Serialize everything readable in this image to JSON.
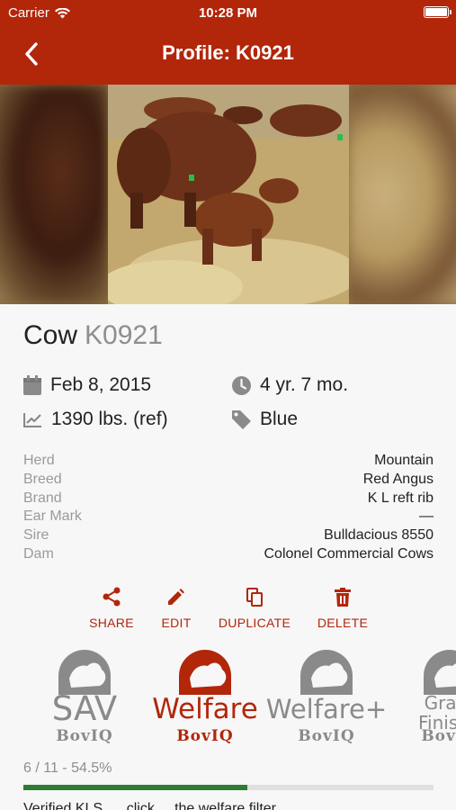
{
  "status_bar": {
    "carrier": "Carrier",
    "time": "10:28 PM",
    "wifi_icon": "wifi-icon",
    "battery_icon": "battery-icon"
  },
  "nav": {
    "title": "Profile: K0921",
    "back_icon": "chevron-left-icon"
  },
  "animal": {
    "kind": "Cow",
    "tag": "K0921",
    "birth_date": "Feb 8, 2015",
    "age": "4 yr. 7 mo.",
    "weight": "1390 lbs. (ref)",
    "tag_color": "Blue"
  },
  "details": [
    {
      "label": "Herd",
      "value": "Mountain"
    },
    {
      "label": "Breed",
      "value": "Red Angus"
    },
    {
      "label": "Brand",
      "value": "K L reft rib"
    },
    {
      "label": "Ear Mark",
      "value": "—"
    },
    {
      "label": "Sire",
      "value": "Bulldacious 8550"
    },
    {
      "label": "Dam",
      "value": "Colonel Commercial Cows"
    }
  ],
  "actions": [
    {
      "label": "SHARE",
      "icon": "share-icon"
    },
    {
      "label": "EDIT",
      "icon": "pencil-icon"
    },
    {
      "label": "DUPLICATE",
      "icon": "copy-icon"
    },
    {
      "label": "DELETE",
      "icon": "trash-icon"
    }
  ],
  "programs": [
    {
      "big": "SAV",
      "small": "BovIQ",
      "state": "inactive"
    },
    {
      "big": "Welfare",
      "small": "BovIQ",
      "state": "active"
    },
    {
      "big": "Welfare+",
      "small": "BovIQ",
      "state": "inactive"
    },
    {
      "big": "Grass Finished",
      "small": "BovIQ",
      "state": "inactive"
    }
  ],
  "progress": {
    "label": "6 / 11 - 54.5%",
    "fraction": 0.545
  },
  "footer_note": "Verified KLS ..., click ... the welfare filter",
  "colors": {
    "brand": "#b2260a",
    "progress": "#2e7d32",
    "muted": "#8e8e8e"
  }
}
